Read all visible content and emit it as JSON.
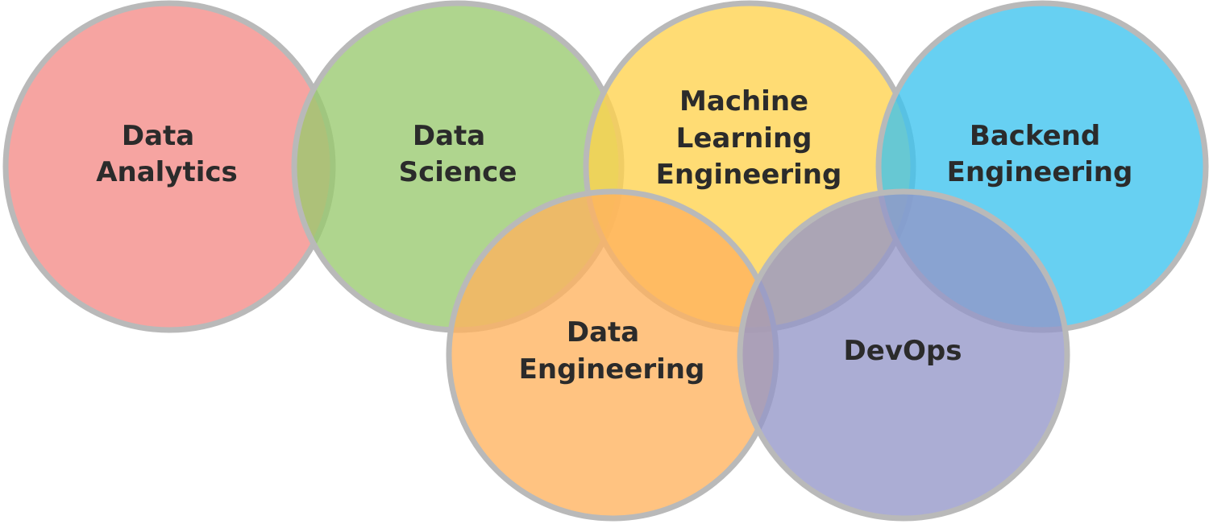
{
  "colors": {
    "data_analytics": "#f48a86",
    "data_science": "#98c96e",
    "machine_learning_engineering": "#ffd24d",
    "backend_engineering": "#3cc3ee",
    "data_engineering": "#ffb25e",
    "devops": "#9496c8",
    "outline": "#b9b9b9",
    "label": "#2b2b2b"
  },
  "circles": [
    {
      "key": "data_analytics",
      "lines": [
        "Data",
        "Analytics"
      ]
    },
    {
      "key": "data_science",
      "lines": [
        "Data",
        "Science"
      ]
    },
    {
      "key": "machine_learning_engineering",
      "lines": [
        "Machine",
        "Learning",
        "Engineering"
      ]
    },
    {
      "key": "backend_engineering",
      "lines": [
        "Backend",
        "Engineering"
      ]
    },
    {
      "key": "data_engineering",
      "lines": [
        "Data",
        "Engineering"
      ]
    },
    {
      "key": "devops",
      "lines": [
        "DevOps"
      ]
    }
  ]
}
